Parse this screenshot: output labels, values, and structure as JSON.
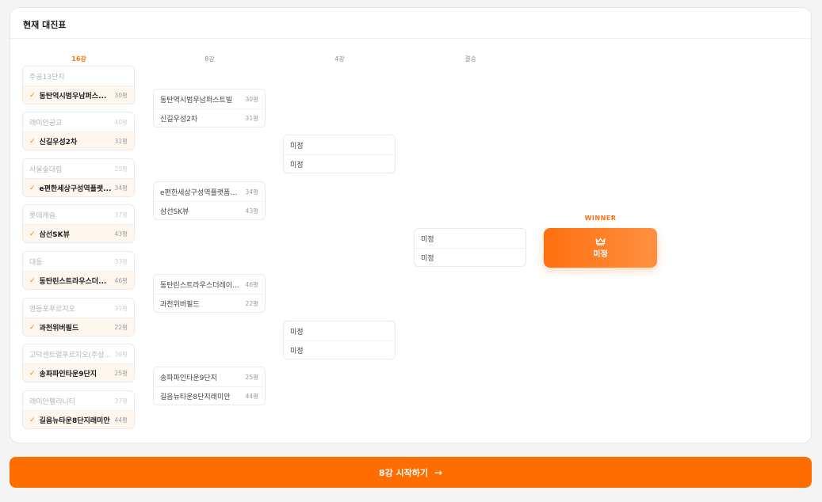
{
  "header": {
    "title": "현재 대진표"
  },
  "columns": {
    "r16": "16강",
    "r8": "8강",
    "r4": "4강",
    "final": "결승"
  },
  "round16": [
    {
      "top": {
        "name": "주공13단지",
        "pyeong": ""
      },
      "bottom": {
        "name": "동탄역시범우남퍼스...",
        "pyeong": "30평"
      }
    },
    {
      "top": {
        "name": "래미안공교",
        "pyeong": "40평"
      },
      "bottom": {
        "name": "신길우성2차",
        "pyeong": "31평"
      }
    },
    {
      "top": {
        "name": "서울숲대림",
        "pyeong": "25평"
      },
      "bottom": {
        "name": "e편한세상구성역플랫...",
        "pyeong": "34평"
      }
    },
    {
      "top": {
        "name": "롯데캐슬",
        "pyeong": "37평"
      },
      "bottom": {
        "name": "삼선SK뷰",
        "pyeong": "43평"
      }
    },
    {
      "top": {
        "name": "대동",
        "pyeong": "33평"
      },
      "bottom": {
        "name": "동탄린스트라우스더...",
        "pyeong": "46평"
      }
    },
    {
      "top": {
        "name": "영등포푸르지오",
        "pyeong": "31평"
      },
      "bottom": {
        "name": "과천위버필드",
        "pyeong": "22평"
      }
    },
    {
      "top": {
        "name": "고덕센트럴푸르지오(주상...",
        "pyeong": "36평"
      },
      "bottom": {
        "name": "송파파인타운9단지",
        "pyeong": "25평"
      }
    },
    {
      "top": {
        "name": "래미안펠리니티",
        "pyeong": "37평"
      },
      "bottom": {
        "name": "길음뉴타운8단지래미안",
        "pyeong": "44평"
      }
    }
  ],
  "round8": [
    {
      "top": {
        "name": "동탄역시범우남퍼스트빌",
        "pyeong": "30평"
      },
      "bottom": {
        "name": "신길우성2차",
        "pyeong": "31평"
      }
    },
    {
      "top": {
        "name": "e편한세상구성역플랫폼시...",
        "pyeong": "34평"
      },
      "bottom": {
        "name": "삼선SK뷰",
        "pyeong": "43평"
      }
    },
    {
      "top": {
        "name": "동탄린스트라우스더레이...",
        "pyeong": "46평"
      },
      "bottom": {
        "name": "과천위버필드",
        "pyeong": "22평"
      }
    },
    {
      "top": {
        "name": "송파파인타운9단지",
        "pyeong": "25평"
      },
      "bottom": {
        "name": "길음뉴타운8단지래미안",
        "pyeong": "44평"
      }
    }
  ],
  "round4": [
    {
      "top": {
        "name": "미정"
      },
      "bottom": {
        "name": "미정"
      }
    },
    {
      "top": {
        "name": "미정"
      },
      "bottom": {
        "name": "미정"
      }
    }
  ],
  "final": {
    "top": {
      "name": "미정"
    },
    "bottom": {
      "name": "미정"
    }
  },
  "winner": {
    "label": "WINNER",
    "value": "미정"
  },
  "actions": {
    "start": "8강 시작하기"
  },
  "colors": {
    "accent": "#ff6d00",
    "check": "#ff7a1f"
  },
  "icons": {
    "check": "check-icon",
    "crown": "crown-icon",
    "arrow": "arrow-right-icon"
  }
}
